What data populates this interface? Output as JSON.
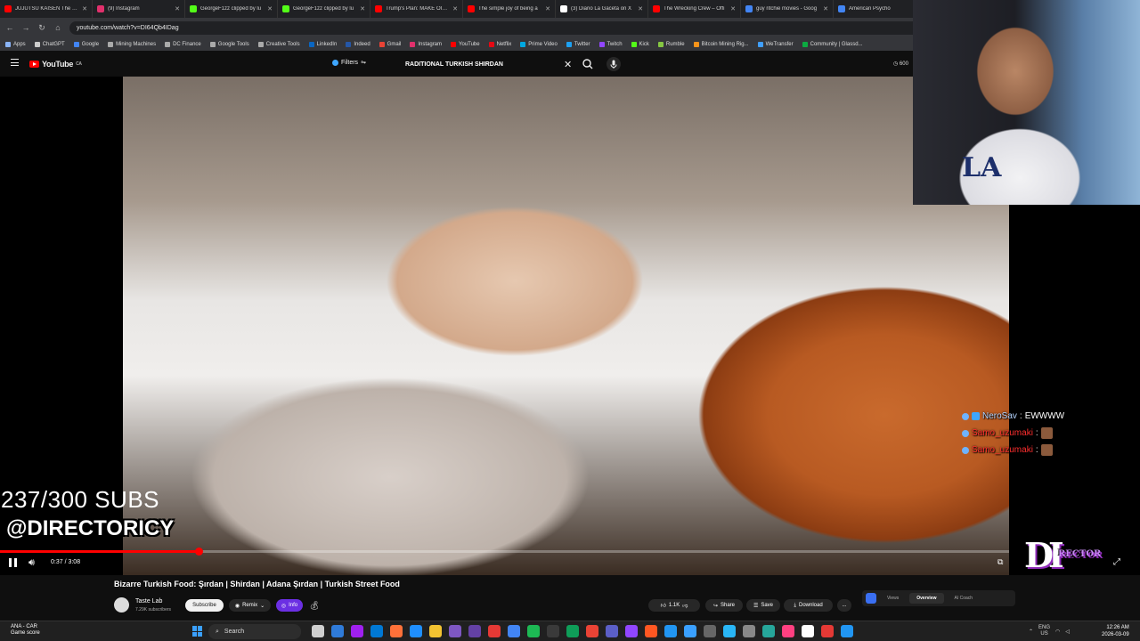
{
  "browser": {
    "tabs": [
      {
        "title": "JUJUTSU KAISEN The Culli",
        "color": "#ff0000"
      },
      {
        "title": "(9) Instagram",
        "color": "#e1306c"
      },
      {
        "title": "GeorgeF1zz clipped by lu",
        "color": "#53fc18"
      },
      {
        "title": "GeorgeF1zz clipped by lu",
        "color": "#53fc18"
      },
      {
        "title": "Trump's Plan: MAKE OIL C",
        "color": "#ff0000"
      },
      {
        "title": "The simple joy of being a",
        "color": "#ff0000"
      },
      {
        "title": "(3) Diario La Gaceta on X",
        "color": "#ffffff"
      },
      {
        "title": "The Wrecking Crew – Offi",
        "color": "#ff0000"
      },
      {
        "title": "guy ritchie movies - Goog",
        "color": "#4285f4"
      },
      {
        "title": "American Psycho",
        "color": "#4285f4"
      }
    ],
    "url": "youtube.com/watch?v=DI64Qb4IDag",
    "bookmarks": [
      {
        "label": "Apps",
        "color": "#8ab4f8"
      },
      {
        "label": "ChatGPT",
        "color": "#cccccc"
      },
      {
        "label": "Google",
        "color": "#4285f4"
      },
      {
        "label": "Mining Machines",
        "color": "#aaaaaa"
      },
      {
        "label": "DC Finance",
        "color": "#aaaaaa"
      },
      {
        "label": "Google Tools",
        "color": "#aaaaaa"
      },
      {
        "label": "Creative Tools",
        "color": "#aaaaaa"
      },
      {
        "label": "LinkedIn",
        "color": "#0a66c2"
      },
      {
        "label": "Indeed",
        "color": "#2557a7"
      },
      {
        "label": "Gmail",
        "color": "#ea4335"
      },
      {
        "label": "Instagram",
        "color": "#e1306c"
      },
      {
        "label": "YouTube",
        "color": "#ff0000"
      },
      {
        "label": "Netflix",
        "color": "#e50914"
      },
      {
        "label": "Prime Video",
        "color": "#00a8e1"
      },
      {
        "label": "Twitter",
        "color": "#1da1f2"
      },
      {
        "label": "Twitch",
        "color": "#9146ff"
      },
      {
        "label": "Kick",
        "color": "#53fc18"
      },
      {
        "label": "Rumble",
        "color": "#85c742"
      },
      {
        "label": "Bitcoin Mining Rig...",
        "color": "#f7931a"
      },
      {
        "label": "WeTransfer",
        "color": "#409fff"
      },
      {
        "label": "Community | Glassd...",
        "color": "#0caa41"
      }
    ]
  },
  "youtube": {
    "logo": "YouTube",
    "country": "CA",
    "filters_label": "Filters",
    "search_query": "RADITIONAL TURKISH SHIRDAN",
    "counter": "600"
  },
  "stream": {
    "subs_count": "237/300 SUBS",
    "handle": "@DIRECTORICY",
    "logo_text": "DI",
    "logo_sub": "RECTOR",
    "chat": [
      {
        "user": "NeroSav",
        "message": "EWWWW",
        "user_color": "#b5d5ff"
      },
      {
        "user": "Samo_uzumaki",
        "message": "",
        "user_color": "#ff2e2e"
      },
      {
        "user": "Samo_uzumaki",
        "message": "",
        "user_color": "#ff2e2e"
      }
    ],
    "webcam_logo": "LA"
  },
  "player": {
    "time_display": "0:37 / 3:08",
    "progress": 0.197
  },
  "video": {
    "title": "Bizarre Turkish Food: Şırdan | Shirdan | Adana Şırdan | Turkish Street Food",
    "channel_name": "Taste Lab",
    "channel_subs": "7.29K subscribers",
    "subscribe_label": "Subscribe",
    "remix_label": "Remix",
    "info_label": "Info",
    "like_count": "1.1K",
    "share_label": "Share",
    "save_label": "Save",
    "download_label": "Download",
    "more_label": "...",
    "panel_tabs": [
      "Views",
      "Overview",
      "AI Coach"
    ]
  },
  "taskbar": {
    "weather_title": "ANA - CAR",
    "weather_sub": "Game score",
    "search_label": "Search",
    "app_colors": [
      "#cfcfcf",
      "#2f7bd9",
      "#a020f0",
      "#0078d4",
      "#ff7139",
      "#1f8fff",
      "#f3c331",
      "#7e57c2",
      "#6441a5",
      "#e53935",
      "#4285f4",
      "#1db954",
      "#3a3a3a",
      "#0f9d58",
      "#ea4335",
      "#5b5fc7",
      "#9146ff",
      "#ff5722",
      "#2196f3",
      "#3aa0ff",
      "#666666",
      "#29b6f6",
      "#888888",
      "#26a69a",
      "#ff4081",
      "#ffffff",
      "#e53935",
      "#2196f3"
    ],
    "lang_top": "ENG",
    "lang_bottom": "US",
    "time": "12:26 AM",
    "date": "2026-03-09"
  }
}
